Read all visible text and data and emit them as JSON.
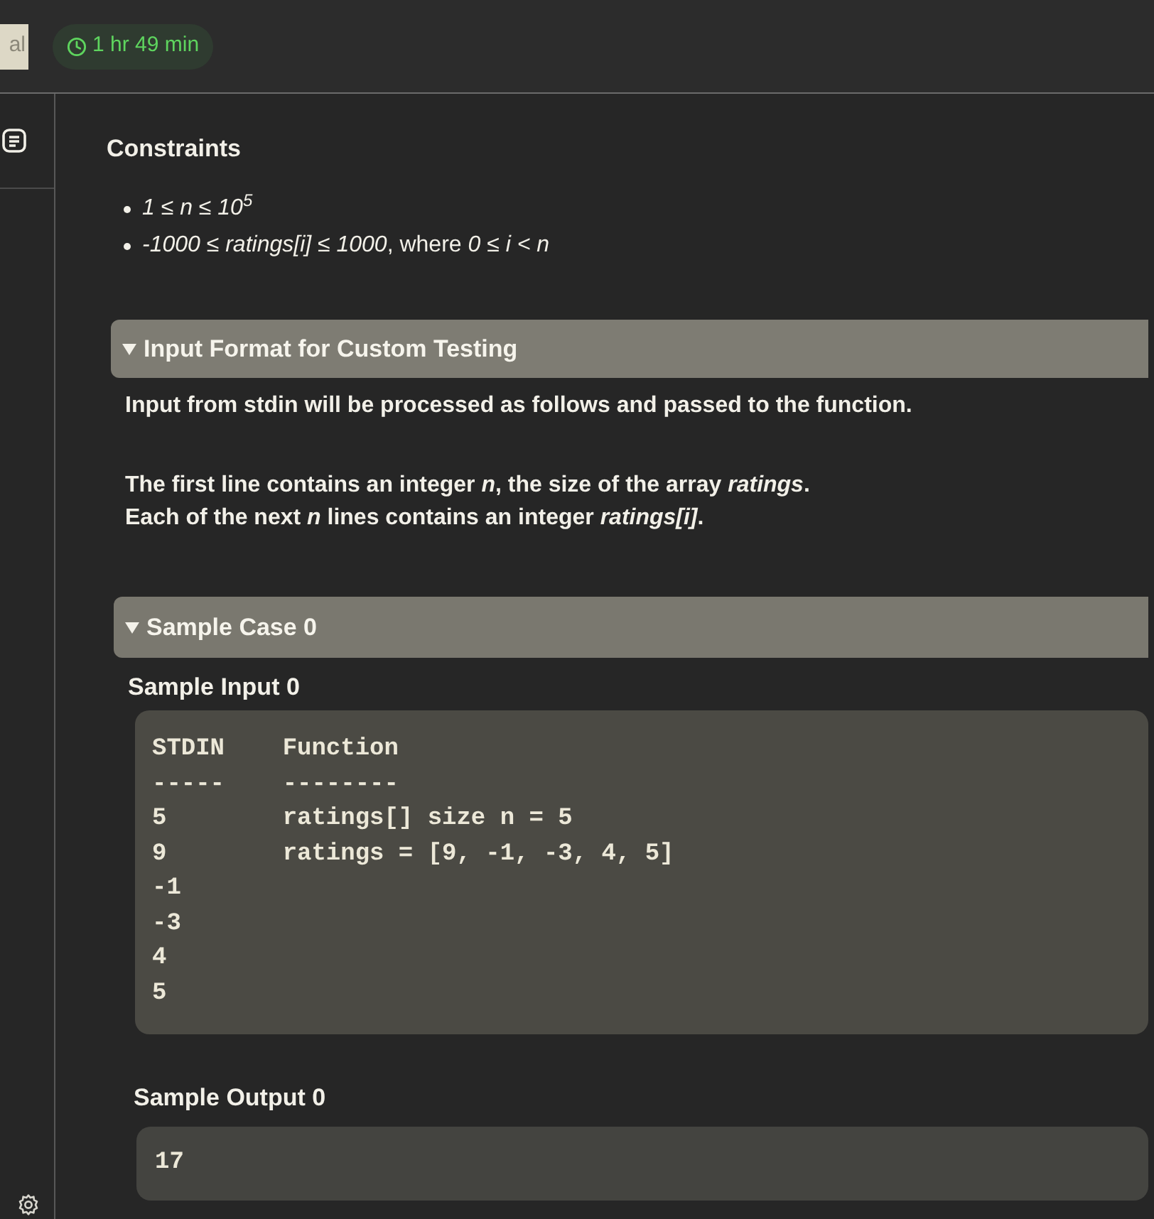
{
  "top_bar": {
    "cut_tab": "al",
    "timer": "1 hr 49 min"
  },
  "constraints": {
    "title": "Constraints",
    "items": [
      {
        "kind": "math",
        "text": "1 ≤ n ≤ 10$^{5}$"
      },
      {
        "kind": "mixed",
        "text": "*-1000 ≤ ratings[i] ≤ 1000*, where *0 ≤ i < n*"
      }
    ]
  },
  "sections": [
    {
      "kind": "text",
      "title": "Input Format for Custom Testing",
      "expanded": true,
      "paragraphs": [
        [
          "Input from stdin will be processed as follows and passed to the function."
        ],
        [
          "The first line contains an integer *n*, the size of the array *ratings*.",
          "Each of the next *n* lines contains an integer *ratings[i]*."
        ]
      ]
    },
    {
      "kind": "sample",
      "title": "Sample Case 0",
      "expanded": true,
      "sample_input": {
        "title": "Sample Input 0",
        "lines": [
          "STDIN    Function",
          "-----    --------",
          "5        ratings[] size n = 5",
          "9        ratings = [9, -1, -3, 4, 5]",
          "-1",
          "-3",
          "4",
          "5"
        ]
      },
      "sample_output": {
        "title": "Sample Output 0",
        "lines": [
          "17"
        ]
      }
    }
  ]
}
